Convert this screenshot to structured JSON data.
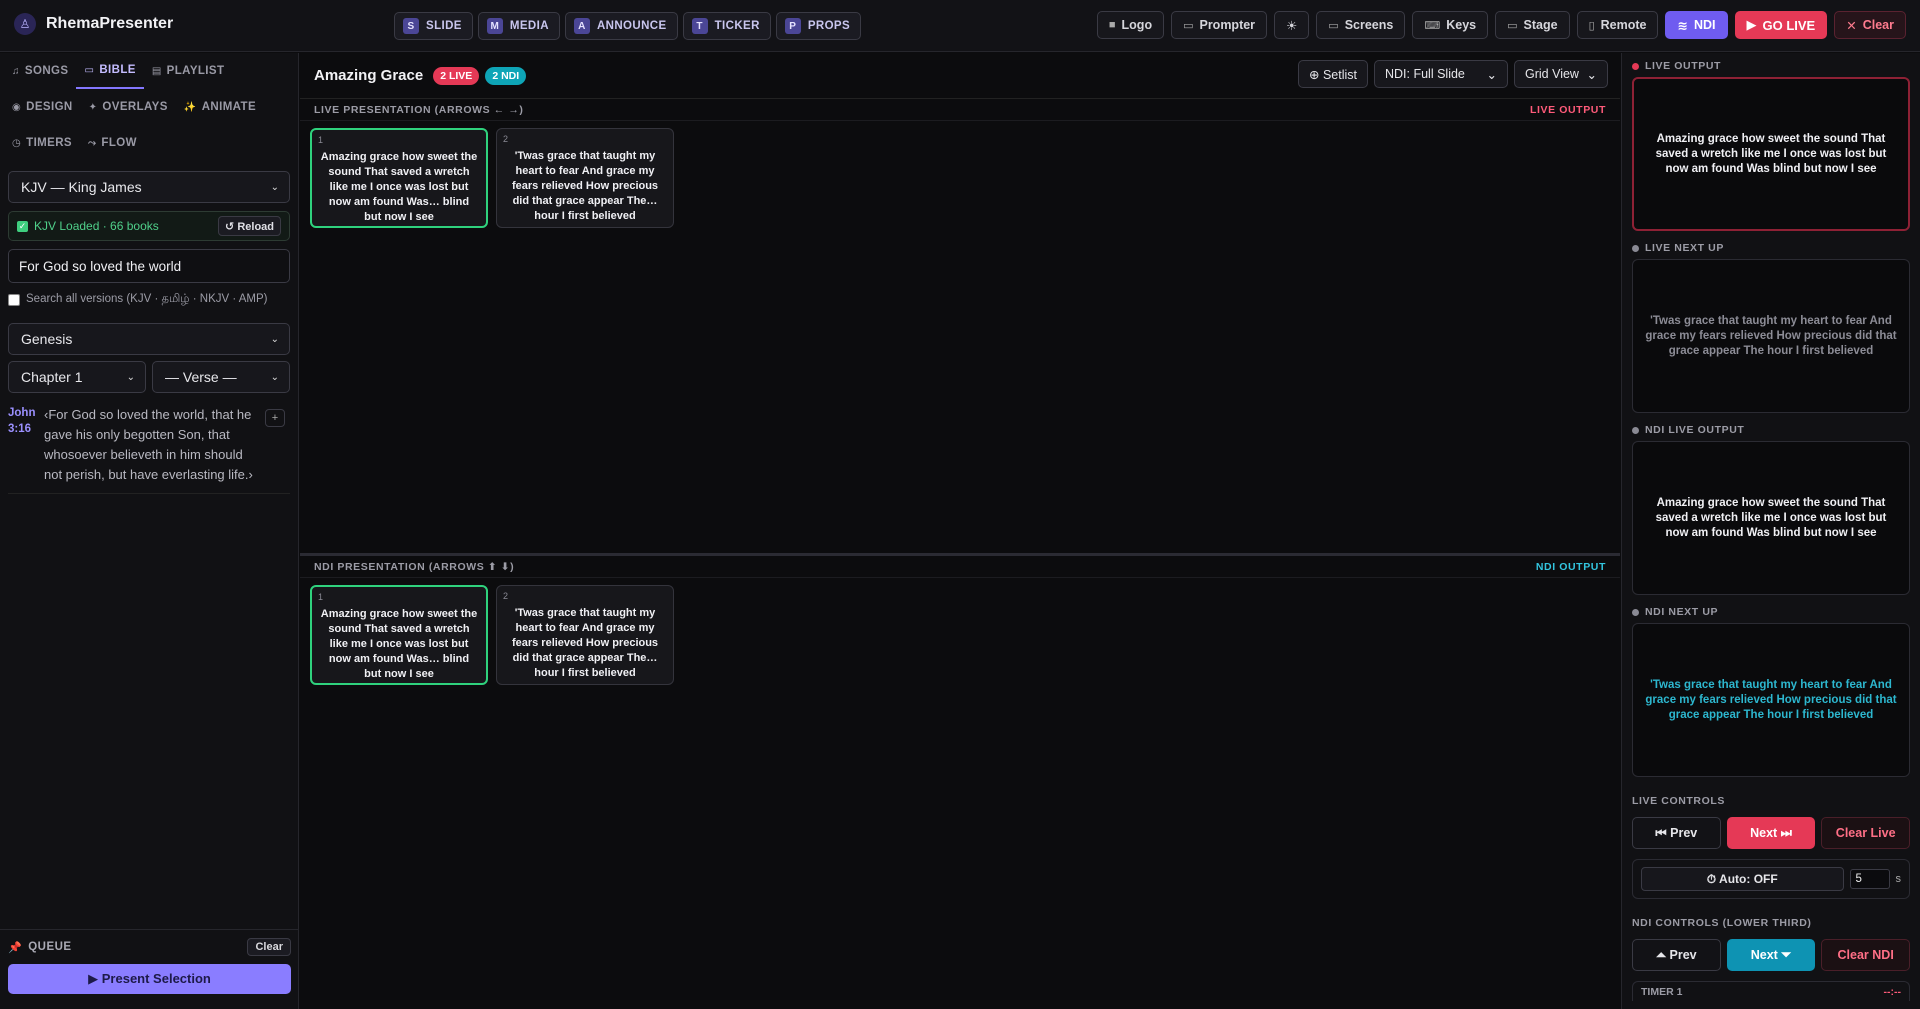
{
  "app": {
    "name": "RhemaPresenter",
    "logo_glyph": "♙"
  },
  "modes": [
    {
      "key": "S",
      "label": "SLIDE"
    },
    {
      "key": "M",
      "label": "MEDIA"
    },
    {
      "key": "A",
      "label": "ANNOUNCE"
    },
    {
      "key": "T",
      "label": "TICKER"
    },
    {
      "key": "P",
      "label": "PROPS"
    }
  ],
  "actions": {
    "logo": "Logo",
    "prompter": "Prompter",
    "theme": "☀",
    "screens": "Screens",
    "keys": "Keys",
    "stage": "Stage",
    "remote": "Remote",
    "ndi": "NDI",
    "go_live": "GO LIVE",
    "clear": "Clear"
  },
  "sidebar": {
    "tabs": [
      {
        "icon": "♫",
        "label": "SONGS"
      },
      {
        "icon": "▭",
        "label": "BIBLE",
        "active": true
      },
      {
        "icon": "▤",
        "label": "PLAYLIST"
      },
      {
        "icon": "◉",
        "label": "DESIGN"
      },
      {
        "icon": "✦",
        "label": "OVERLAYS"
      },
      {
        "icon": "✨",
        "label": "ANIMATE"
      },
      {
        "icon": "◷",
        "label": "TIMERS"
      },
      {
        "icon": "⤳",
        "label": "FLOW"
      }
    ],
    "version_select": "KJV — King James",
    "loaded_status": "KJV Loaded · 66 books",
    "reload_label": "↺ Reload",
    "search_value": "For God so loved the world",
    "search_all_label": "Search all versions (KJV · தமிழ் · NKJV · AMP)",
    "book_select": "Genesis",
    "chapter_select": "Chapter 1",
    "verse_select": "— Verse —",
    "result": {
      "ref": "John 3:16",
      "text": "‹For God so loved the world, that he gave his only begotten Son, that whosoever believeth in him should not perish, but have everlasting life.›",
      "add": "+"
    },
    "queue": {
      "title": "QUEUE",
      "clear": "Clear",
      "present": "▶ Present Selection"
    }
  },
  "main": {
    "title": "Amazing Grace",
    "badge_live": "2 LIVE",
    "badge_ndi": "2 NDI",
    "setlist": "⊕ Setlist",
    "ndi_mode": "NDI: Full Slide",
    "view_mode": "Grid View",
    "live_section": {
      "title": "LIVE PRESENTATION (ARROWS ← →)",
      "tag": "LIVE OUTPUT"
    },
    "ndi_section": {
      "title": "NDI PRESENTATION (ARROWS ⬆ ⬇)",
      "tag": "NDI OUTPUT"
    },
    "slides": [
      {
        "num": "1",
        "text": "Amazing grace how sweet the sound That saved a wretch like me I once was lost but now am found Was… blind but now I see"
      },
      {
        "num": "2",
        "text": "'Twas grace that taught my heart to fear And grace my fears relieved How precious did that grace appear The… hour I first believed"
      }
    ]
  },
  "right": {
    "live_output": {
      "label": "LIVE OUTPUT",
      "text": "Amazing grace how sweet the sound That saved a wretch like me I once was lost but now am found Was blind but now I see"
    },
    "live_next": {
      "label": "LIVE NEXT UP",
      "text": "'Twas grace that taught my heart to fear And grace my fears relieved How precious did that grace appear The hour I first believed"
    },
    "ndi_output": {
      "label": "NDI LIVE OUTPUT",
      "text": "Amazing grace how sweet the sound That saved a wretch like me I once was lost but now am found Was blind but now I see"
    },
    "ndi_next": {
      "label": "NDI NEXT UP",
      "text": "'Twas grace that taught my heart to fear And grace my fears relieved How precious did that grace appear The hour I first believed"
    },
    "live_controls": {
      "label": "LIVE CONTROLS",
      "prev": "⏮ Prev",
      "next": "Next ⏭",
      "clear": "Clear Live"
    },
    "auto": {
      "label": "⏱ Auto: OFF",
      "seconds": "5",
      "unit": "s"
    },
    "ndi_controls": {
      "label": "NDI CONTROLS (LOWER THIRD)",
      "prev": "⏶ Prev",
      "next": "Next ⏷",
      "clear": "Clear NDI"
    },
    "timer": {
      "label": "TIMER 1",
      "value": "--:--"
    }
  },
  "colors": {
    "accent": "#8477ff",
    "live": "#e53956",
    "ndi": "#0ea5b7",
    "active_slide": "#2fd27d"
  }
}
